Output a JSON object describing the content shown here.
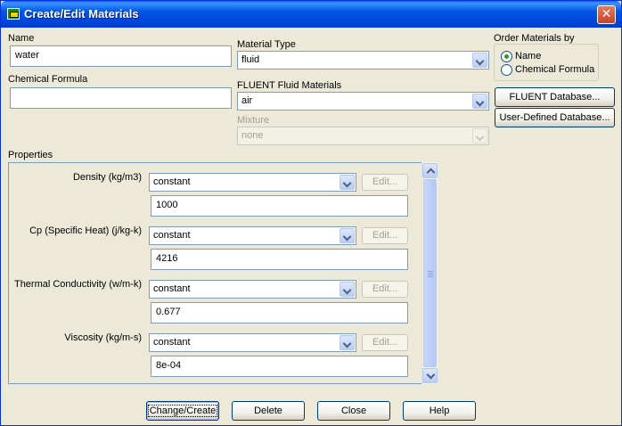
{
  "window": {
    "title": "Create/Edit Materials",
    "close_glyph": "✕"
  },
  "name": {
    "label": "Name",
    "value": "water"
  },
  "chemical_formula": {
    "label": "Chemical Formula",
    "value": ""
  },
  "material_type": {
    "label": "Material Type",
    "selected": "fluid"
  },
  "fluent_fluid_materials": {
    "label": "FLUENT Fluid Materials",
    "selected": "air"
  },
  "mixture": {
    "label": "Mixture",
    "selected": "none",
    "disabled": true
  },
  "order_by": {
    "label": "Order Materials by",
    "options": [
      {
        "label": "Name",
        "checked": true
      },
      {
        "label": "Chemical Formula",
        "checked": false
      }
    ]
  },
  "database_buttons": {
    "fluent": "FLUENT Database...",
    "user_defined": "User-Defined Database..."
  },
  "properties": {
    "label": "Properties",
    "items": [
      {
        "label": "Density (kg/m3)",
        "method": "constant",
        "edit": "Edit...",
        "value": "1000"
      },
      {
        "label": "Cp (Specific Heat) (j/kg-k)",
        "method": "constant",
        "edit": "Edit...",
        "value": "4216"
      },
      {
        "label": "Thermal Conductivity (w/m-k)",
        "method": "constant",
        "edit": "Edit...",
        "value": "0.677"
      },
      {
        "label": "Viscosity (kg/m-s)",
        "method": "constant",
        "edit": "Edit...",
        "value": "8e-04"
      }
    ]
  },
  "footer": {
    "change_create": "Change/Create",
    "delete": "Delete",
    "close": "Close",
    "help": "Help"
  },
  "colors": {
    "titlebar": "#0055e5",
    "dialog_bg": "#ece9d8",
    "field_border": "#7f9db9",
    "disabled_text": "#a3a08e"
  }
}
